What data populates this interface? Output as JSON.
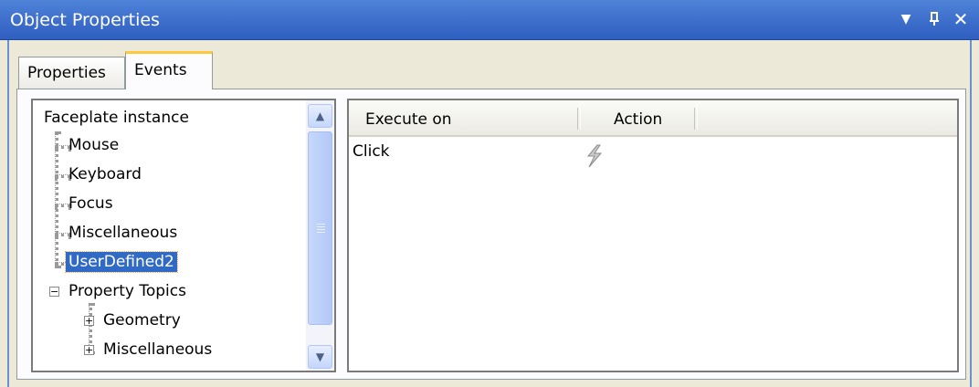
{
  "window": {
    "title": "Object Properties"
  },
  "title_buttons": [
    {
      "name": "dropdown-icon",
      "glyph": "▼"
    },
    {
      "name": "pin-icon",
      "glyph": "ᆷ"
    },
    {
      "name": "close-icon",
      "glyph": "✕"
    }
  ],
  "tabs": [
    {
      "label": "Properties",
      "active": false
    },
    {
      "label": "Events",
      "active": true
    }
  ],
  "tree": {
    "root": "Faceplate instance",
    "children": [
      "Mouse",
      "Keyboard",
      "Focus",
      "Miscellaneous",
      "UserDefined2"
    ],
    "selected": "UserDefined2",
    "property_topics": "Property Topics",
    "topic_children": [
      "Geometry",
      "Miscellaneous"
    ],
    "collapse_glyph": "−",
    "expand_glyph": "+"
  },
  "scroll": {
    "up_glyph": "▲",
    "down_glyph": "▼"
  },
  "grid": {
    "columns": [
      "Execute on",
      "Action"
    ],
    "rows": [
      {
        "execute_on": "Click",
        "action_icon": "lightning-icon"
      }
    ]
  }
}
